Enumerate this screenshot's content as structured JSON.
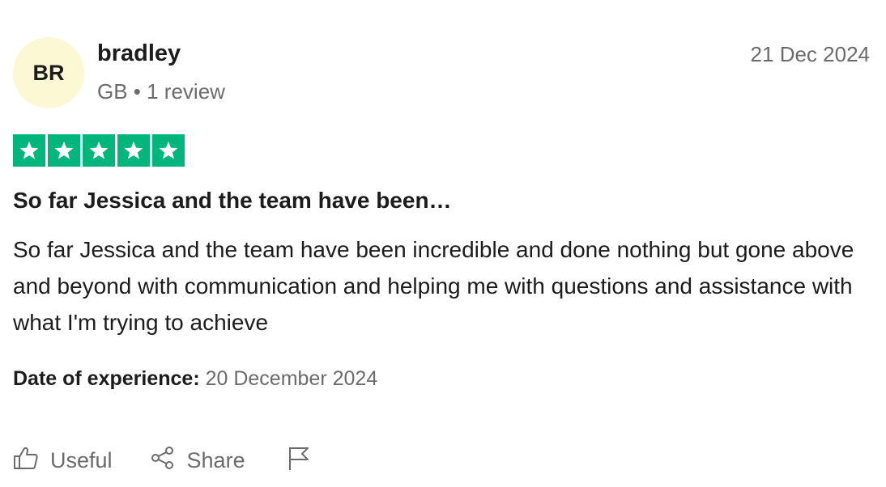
{
  "reviewer": {
    "initials": "BR",
    "name": "bradley",
    "meta": "GB • 1 review",
    "avatar_color": "#fcf8d4"
  },
  "review_date": "21 Dec 2024",
  "rating": {
    "stars": 5,
    "max": 5,
    "color": "#00b67a"
  },
  "review": {
    "title": "So far Jessica and the team have been…",
    "body": "So far Jessica and the team have been incredible and done nothing but gone above and beyond with communication and helping me with questions and assistance with what I'm trying to achieve"
  },
  "experience": {
    "label": "Date of experience:",
    "value": "20 December 2024"
  },
  "actions": {
    "useful_label": "Useful",
    "useful_icon": "thumbs-up-icon",
    "share_label": "Share",
    "share_icon": "share-icon",
    "report_icon": "flag-icon"
  }
}
